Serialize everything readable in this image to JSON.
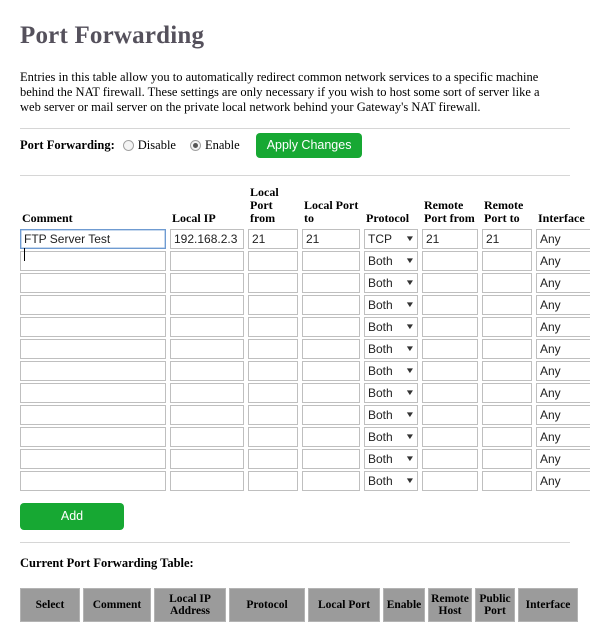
{
  "page": {
    "title": "Port Forwarding",
    "intro": "Entries in this table allow you to automatically redirect common network services to a specific machine behind the NAT firewall. These settings are only necessary if you wish to host some sort of server like a web server or mail server on the private local network behind your Gateway's NAT firewall."
  },
  "controls": {
    "label": "Port Forwarding:",
    "disable_label": "Disable",
    "enable_label": "Enable",
    "selected": "Enable",
    "apply_label": "Apply Changes",
    "add_label": "Add",
    "accent_color": "#17a833"
  },
  "entry_table": {
    "headers": {
      "comment": "Comment",
      "local_ip": "Local IP",
      "local_port_from": "Local Port from",
      "local_port_to": "Local Port to",
      "protocol": "Protocol",
      "remote_port_from": "Remote Port from",
      "remote_port_to": "Remote Port to",
      "interface": "Interface"
    },
    "rows": [
      {
        "comment": "FTP Server Test",
        "local_ip": "192.168.2.3",
        "local_port_from": "21",
        "local_port_to": "21",
        "protocol": "TCP",
        "remote_port_from": "21",
        "remote_port_to": "21",
        "interface": "Any",
        "focused": true
      },
      {
        "comment": "",
        "local_ip": "",
        "local_port_from": "",
        "local_port_to": "",
        "protocol": "Both",
        "remote_port_from": "",
        "remote_port_to": "",
        "interface": "Any",
        "focused": false
      },
      {
        "comment": "",
        "local_ip": "",
        "local_port_from": "",
        "local_port_to": "",
        "protocol": "Both",
        "remote_port_from": "",
        "remote_port_to": "",
        "interface": "Any",
        "focused": false
      },
      {
        "comment": "",
        "local_ip": "",
        "local_port_from": "",
        "local_port_to": "",
        "protocol": "Both",
        "remote_port_from": "",
        "remote_port_to": "",
        "interface": "Any",
        "focused": false
      },
      {
        "comment": "",
        "local_ip": "",
        "local_port_from": "",
        "local_port_to": "",
        "protocol": "Both",
        "remote_port_from": "",
        "remote_port_to": "",
        "interface": "Any",
        "focused": false
      },
      {
        "comment": "",
        "local_ip": "",
        "local_port_from": "",
        "local_port_to": "",
        "protocol": "Both",
        "remote_port_from": "",
        "remote_port_to": "",
        "interface": "Any",
        "focused": false
      },
      {
        "comment": "",
        "local_ip": "",
        "local_port_from": "",
        "local_port_to": "",
        "protocol": "Both",
        "remote_port_from": "",
        "remote_port_to": "",
        "interface": "Any",
        "focused": false
      },
      {
        "comment": "",
        "local_ip": "",
        "local_port_from": "",
        "local_port_to": "",
        "protocol": "Both",
        "remote_port_from": "",
        "remote_port_to": "",
        "interface": "Any",
        "focused": false
      },
      {
        "comment": "",
        "local_ip": "",
        "local_port_from": "",
        "local_port_to": "",
        "protocol": "Both",
        "remote_port_from": "",
        "remote_port_to": "",
        "interface": "Any",
        "focused": false
      },
      {
        "comment": "",
        "local_ip": "",
        "local_port_from": "",
        "local_port_to": "",
        "protocol": "Both",
        "remote_port_from": "",
        "remote_port_to": "",
        "interface": "Any",
        "focused": false
      },
      {
        "comment": "",
        "local_ip": "",
        "local_port_from": "",
        "local_port_to": "",
        "protocol": "Both",
        "remote_port_from": "",
        "remote_port_to": "",
        "interface": "Any",
        "focused": false
      },
      {
        "comment": "",
        "local_ip": "",
        "local_port_from": "",
        "local_port_to": "",
        "protocol": "Both",
        "remote_port_from": "",
        "remote_port_to": "",
        "interface": "Any",
        "focused": false
      }
    ]
  },
  "current_table": {
    "title": "Current Port Forwarding Table:",
    "headers": [
      "Select",
      "Comment",
      "Local IP Address",
      "Protocol",
      "Local Port",
      "Enable",
      "Remote Host",
      "Public Port",
      "Interface"
    ],
    "header_bg": "#9b9b9b",
    "rows": []
  },
  "icons": {
    "dropdown_arrow": "▼"
  }
}
